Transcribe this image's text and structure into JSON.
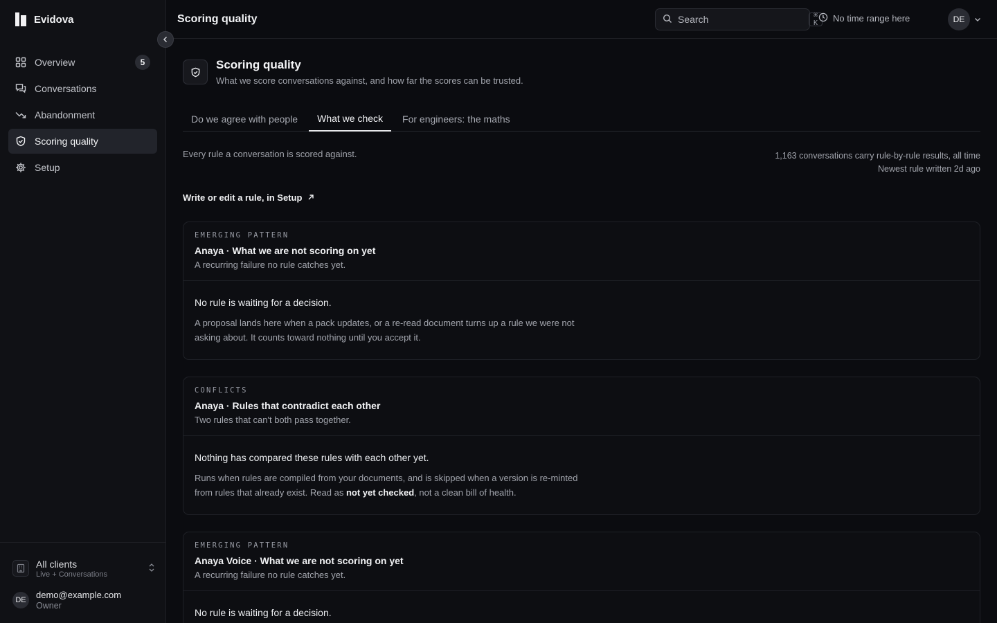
{
  "brand": {
    "name": "Evidova"
  },
  "sidebar": {
    "items": [
      {
        "label": "Overview",
        "badge": "5"
      },
      {
        "label": "Conversations"
      },
      {
        "label": "Abandonment"
      },
      {
        "label": "Scoring quality"
      },
      {
        "label": "Setup"
      }
    ],
    "client": {
      "name": "All clients",
      "sub": "Live + Conversations"
    },
    "user": {
      "initials": "DE",
      "email": "demo@example.com",
      "role": "Owner"
    }
  },
  "topbar": {
    "title": "Scoring quality",
    "search_placeholder": "Search",
    "shortcut": "⌘ K",
    "time_range": "No time range here",
    "avatar_initials": "DE"
  },
  "main": {
    "title": "Scoring quality",
    "subtitle": "What we score conversations against, and how far the scores can be trusted.",
    "tabs": [
      {
        "label": "Do we agree with people"
      },
      {
        "label": "What we check"
      },
      {
        "label": "For engineers: the maths"
      }
    ],
    "intro": "Every rule a conversation is scored against.",
    "stats_line1": "1,163 conversations carry rule-by-rule results, all time",
    "stats_line2": "Newest rule written 2d  ago",
    "setup_link": "Write or edit a rule, in Setup",
    "cards": [
      {
        "eyebrow": "EMERGING PATTERN",
        "title": "Anaya · What we are not scoring on yet",
        "subtitle": "A recurring failure no rule catches yet.",
        "body_heading": "No rule is waiting for a decision.",
        "body_text": "A proposal lands here when a pack updates, or a re-read document turns up a rule we were not asking about. It counts toward nothing until you accept it."
      },
      {
        "eyebrow": "CONFLICTS",
        "title": "Anaya · Rules that contradict each other",
        "subtitle": "Two rules that can't both pass together.",
        "body_heading": "Nothing has compared these rules with each other yet.",
        "body_text_pre": "Runs when rules are compiled from your documents, and is skipped when a version is re-minted from rules that already exist. Read as ",
        "body_text_bold": "not yet checked",
        "body_text_post": ", not a clean bill of health."
      },
      {
        "eyebrow": "EMERGING PATTERN",
        "title": "Anaya Voice · What we are not scoring on yet",
        "subtitle": "A recurring failure no rule catches yet.",
        "body_heading": "No rule is waiting for a decision."
      }
    ]
  }
}
